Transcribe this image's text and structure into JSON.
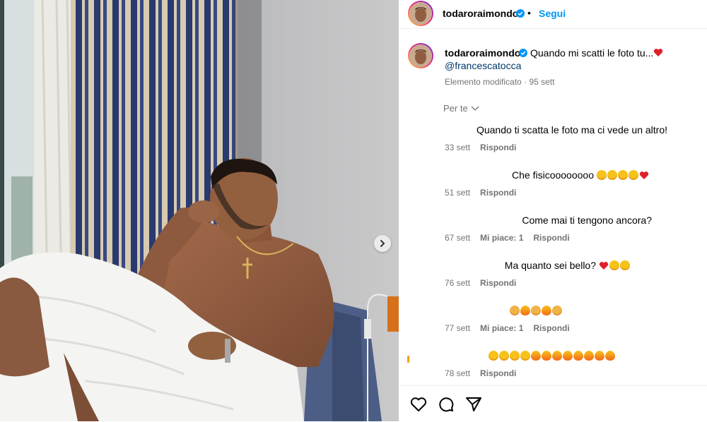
{
  "post": {
    "author": "todaroraimondo",
    "follow_label": "Segui",
    "separator": "•",
    "caption": "Quando mi scatti le foto tu...",
    "mention": "@francescatocca",
    "edited_label": "Elemento modificato",
    "caption_age": "95 sett",
    "translate_label": "Per te"
  },
  "comments": [
    {
      "text": "Quando ti scatta le foto ma ci vede un altro!",
      "emojis": [],
      "age": "33 sett",
      "likes": "",
      "reply": "Rispondi"
    },
    {
      "text": "Che fisicoooooooo",
      "emojis": [
        "sunglasses",
        "heart-eyes",
        "heart-eyes",
        "heart-eyes",
        "red-heart"
      ],
      "age": "51 sett",
      "likes": "",
      "reply": "Rispondi"
    },
    {
      "text": "Come mai ti tengono ancora?",
      "emojis": [],
      "age": "67 sett",
      "likes": "Mi piace: 1",
      "reply": "Rispondi"
    },
    {
      "text": "Ma quanto sei bello?",
      "emojis": [
        "red-heart",
        "smiling-hearts",
        "smiling-hearts"
      ],
      "age": "76 sett",
      "likes": "",
      "reply": "Rispondi"
    },
    {
      "text": "",
      "emojis": [
        "raising-hands",
        "fire",
        "raising-hands",
        "fire",
        "raising-hands"
      ],
      "age": "77 sett",
      "likes": "Mi piace: 1",
      "reply": "Rispondi"
    },
    {
      "text": "",
      "emojis": [
        "heart-eyes",
        "heart-eyes",
        "heart-eyes",
        "heart-eyes",
        "fire",
        "fire",
        "fire",
        "fire",
        "fire",
        "fire",
        "fire",
        "fire"
      ],
      "age": "78 sett",
      "likes": "",
      "reply": "Rispondi"
    }
  ],
  "icons": {
    "verified": "verified-badge-icon",
    "next": "chevron-right-icon",
    "translate": "chevron-down-icon",
    "like": "heart-outline-icon",
    "comment": "comment-bubble-icon",
    "share": "paper-plane-icon"
  },
  "colors": {
    "link": "#0095f6",
    "mention": "#00376b",
    "meta": "#737373"
  }
}
